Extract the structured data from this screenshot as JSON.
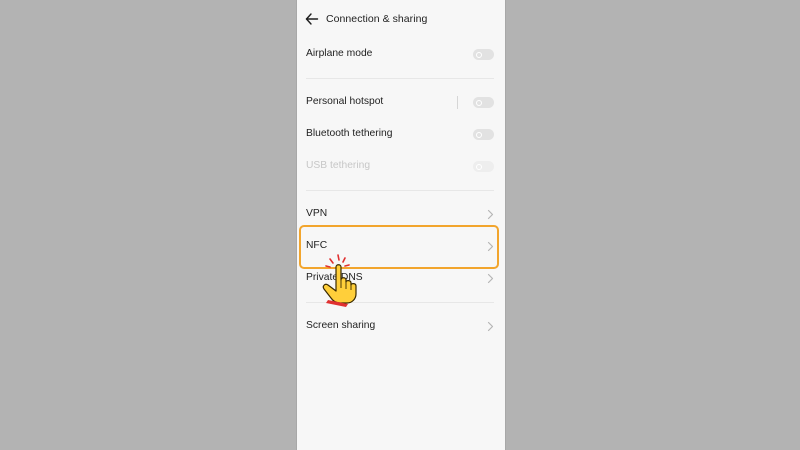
{
  "header": {
    "title": "Connection & sharing"
  },
  "rows": [
    {
      "label": "Airplane mode",
      "control": "toggle",
      "state": "off"
    },
    {
      "label": "Personal hotspot",
      "control": "toggle",
      "state": "off"
    },
    {
      "label": "Bluetooth tethering",
      "control": "toggle",
      "state": "off"
    },
    {
      "label": "USB tethering",
      "control": "toggle",
      "state": "disabled"
    },
    {
      "label": "VPN",
      "control": "chevron"
    },
    {
      "label": "NFC",
      "control": "chevron",
      "highlighted": true
    },
    {
      "label": "Private DNS",
      "control": "chevron"
    },
    {
      "label": "Screen sharing",
      "control": "chevron"
    }
  ],
  "icons": {
    "back": "back-arrow-icon",
    "chevron": "chevron-right-icon",
    "pointer": "tap-hand-icon"
  },
  "colors": {
    "page_background": "#b3b3b3",
    "screen_background": "#f7f7f7",
    "highlight_border": "#f2a52d",
    "disabled_text": "#c7c7c7",
    "hand_fill": "#ffcf3a",
    "hand_cuff": "#e03030"
  }
}
